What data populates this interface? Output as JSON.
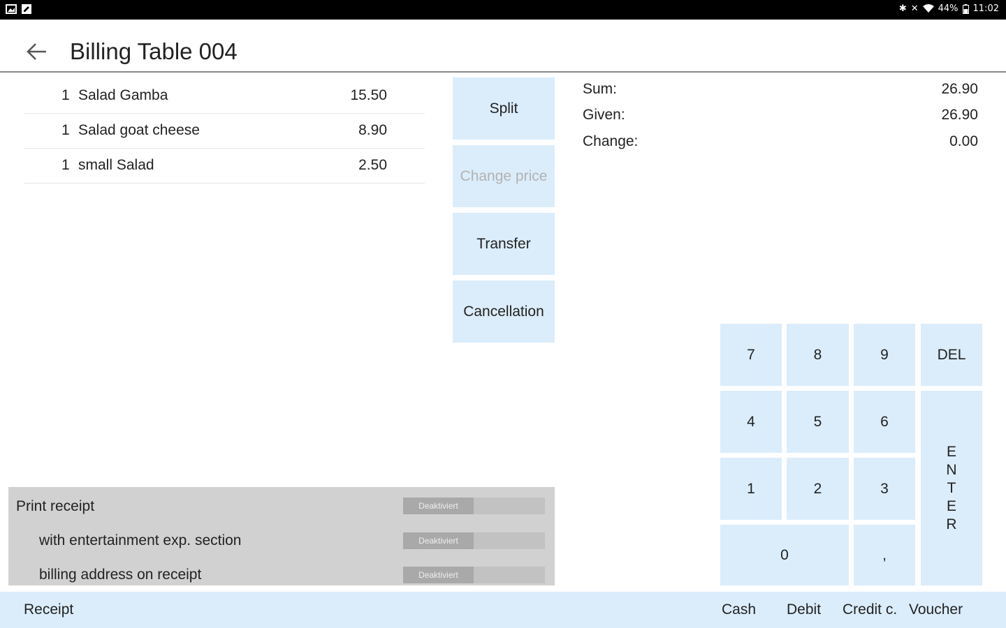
{
  "status_bar": {
    "battery": "44%",
    "time": "11:02"
  },
  "header": {
    "title": "Billing Table 004"
  },
  "order_items": [
    {
      "qty": "1",
      "name": "Salad Gamba",
      "price": "15.50"
    },
    {
      "qty": "1",
      "name": "Salad goat cheese",
      "price": "8.90"
    },
    {
      "qty": "1",
      "name": "small Salad",
      "price": "2.50"
    }
  ],
  "actions": {
    "split": "Split",
    "change_price": "Change price",
    "transfer": "Transfer",
    "cancellation": "Cancellation"
  },
  "totals": {
    "sum_label": "Sum:",
    "sum_value": "26.90",
    "given_label": "Given:",
    "given_value": "26.90",
    "change_label": "Change:",
    "change_value": "0.00"
  },
  "options": {
    "print_receipt": {
      "label": "Print receipt",
      "state": "Deaktiviert"
    },
    "entertainment": {
      "label": "with entertainment exp. section",
      "state": "Deaktiviert"
    },
    "billing_address": {
      "label": "billing address on receipt",
      "state": "Deaktiviert"
    }
  },
  "keypad": {
    "k7": "7",
    "k8": "8",
    "k9": "9",
    "del": "DEL",
    "k4": "4",
    "k5": "5",
    "k6": "6",
    "k1": "1",
    "k2": "2",
    "k3": "3",
    "k0": "0",
    "comma": ",",
    "enter_letters": [
      "E",
      "N",
      "T",
      "E",
      "R"
    ]
  },
  "bottom_bar": {
    "receipt": "Receipt",
    "cash": "Cash",
    "debit": "Debit",
    "credit": "Credit c.",
    "voucher": "Voucher"
  }
}
